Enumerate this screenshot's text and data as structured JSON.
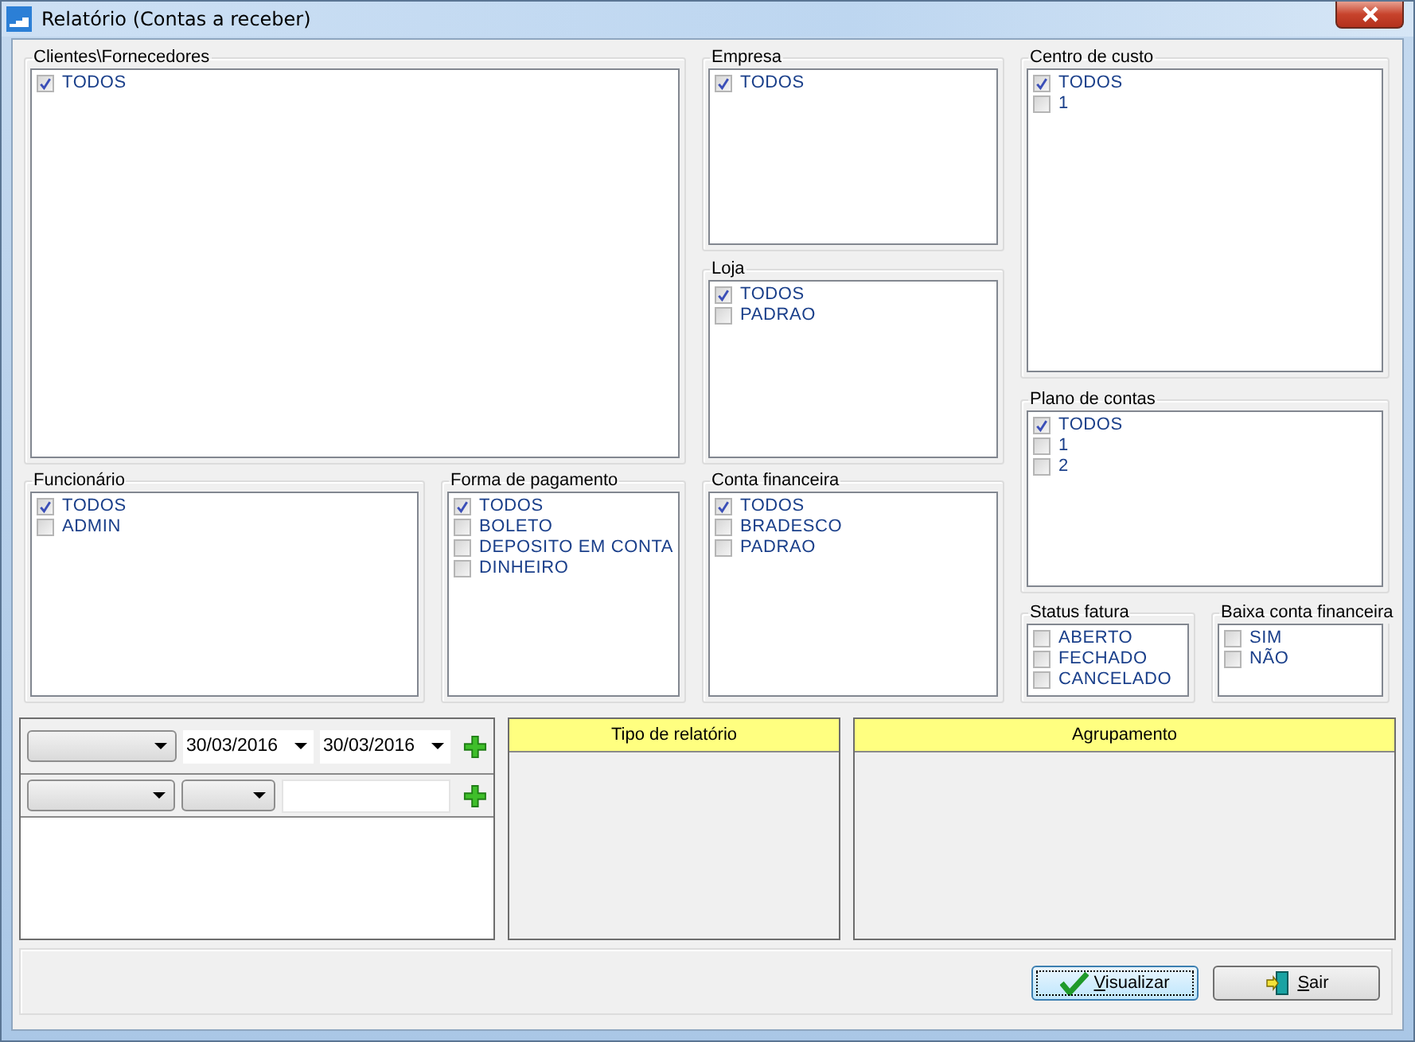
{
  "window": {
    "title": "Relatório (Contas a receber)"
  },
  "groups": [
    {
      "label": "Clientes\\Fornecedores",
      "items": [
        {
          "label": "TODOS",
          "checked": true
        }
      ]
    },
    {
      "label": "Empresa",
      "items": [
        {
          "label": "TODOS",
          "checked": true
        }
      ]
    },
    {
      "label": "Centro de custo",
      "items": [
        {
          "label": "TODOS",
          "checked": true
        },
        {
          "label": "1",
          "checked": false
        }
      ]
    },
    {
      "label": "Loja",
      "items": [
        {
          "label": "TODOS",
          "checked": true
        },
        {
          "label": "PADRAO",
          "checked": false
        }
      ]
    },
    {
      "label": "Plano de contas",
      "items": [
        {
          "label": "TODOS",
          "checked": true
        },
        {
          "label": "1",
          "checked": false
        },
        {
          "label": "2",
          "checked": false
        }
      ]
    },
    {
      "label": "Funcionário",
      "items": [
        {
          "label": "TODOS",
          "checked": true
        },
        {
          "label": "ADMIN",
          "checked": false
        }
      ]
    },
    {
      "label": "Forma de pagamento",
      "items": [
        {
          "label": "TODOS",
          "checked": true
        },
        {
          "label": "BOLETO",
          "checked": false
        },
        {
          "label": "DEPOSITO EM CONTA",
          "checked": false
        },
        {
          "label": "DINHEIRO",
          "checked": false
        }
      ]
    },
    {
      "label": "Conta financeira",
      "items": [
        {
          "label": "TODOS",
          "checked": true
        },
        {
          "label": "BRADESCO",
          "checked": false
        },
        {
          "label": "PADRAO",
          "checked": false
        }
      ]
    },
    {
      "label": "Status fatura",
      "items": [
        {
          "label": "ABERTO",
          "checked": false
        },
        {
          "label": "FECHADO",
          "checked": false
        },
        {
          "label": "CANCELADO",
          "checked": false
        }
      ]
    },
    {
      "label": "Baixa conta financeira",
      "items": [
        {
          "label": "SIM",
          "checked": false
        },
        {
          "label": "NÃO",
          "checked": false
        }
      ]
    }
  ],
  "filters": [
    {
      "fields": [
        {
          "kind": "dropdown"
        },
        {
          "kind": "date",
          "value": "30/03/2016"
        },
        {
          "kind": "date",
          "value": "30/03/2016"
        }
      ]
    },
    {
      "fields": [
        {
          "kind": "dropdown"
        },
        {
          "kind": "small-dropdown"
        },
        {
          "kind": "text"
        }
      ]
    }
  ],
  "panels": [
    {
      "title": "Tipo de relatório"
    },
    {
      "title": "Agrupamento"
    }
  ],
  "buttons": [
    {
      "label": "Visualizar",
      "kind": "confirm",
      "focused": true
    },
    {
      "label": "Sair",
      "kind": "exit",
      "focused": false
    }
  ]
}
